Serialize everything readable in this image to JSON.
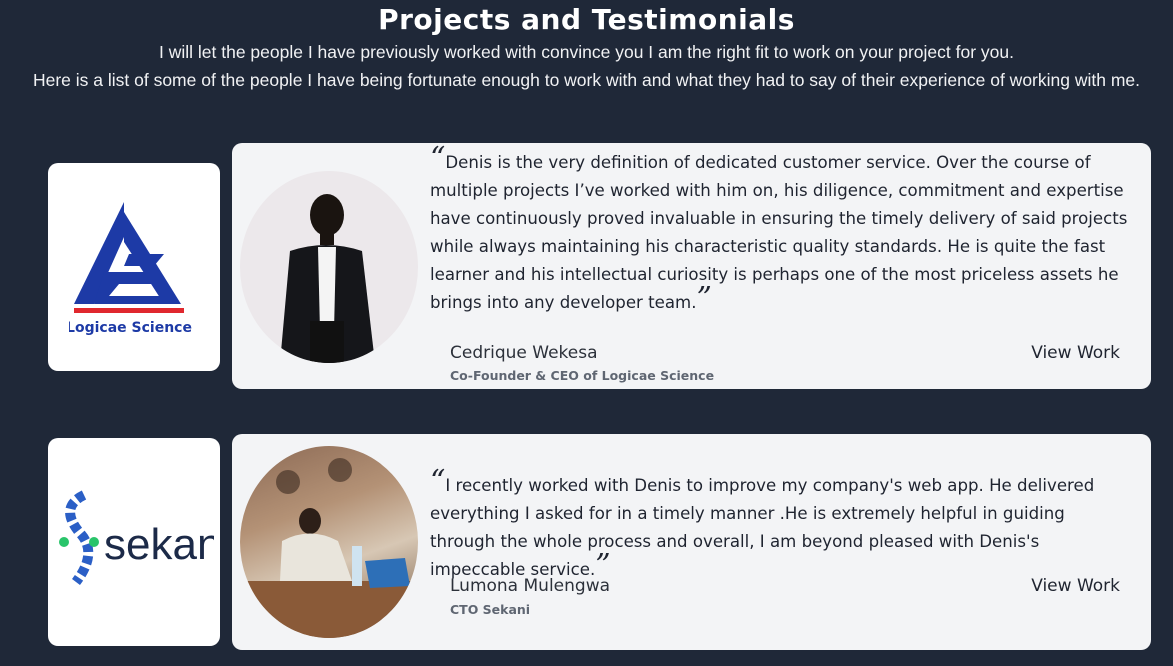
{
  "header": {
    "title": "Projects and Testimonials",
    "intro_line1": "I will let the people I have previously worked with convince you I am the right fit to work on your project for you.",
    "intro_line2": "Here is a list of some of the people I have being fortunate enough to work with and what they had to say of their experience of working with me."
  },
  "testimonials": [
    {
      "company_logo_text": "Logicae Science",
      "quote": "Denis is the very definition of dedicated customer service. Over the course of multiple projects I’ve worked with him on, his diligence, commitment and expertise have continuously proved invaluable in ensuring the timely delivery of said projects while always maintaining his characteristic quality standards. He is quite the fast learner and his intellectual curiosity is perhaps one of the most priceless assets he brings into any developer team.",
      "name": "Cedrique Wekesa",
      "role": "Co-Founder & CEO of Logicae Science",
      "action_label": "View Work"
    },
    {
      "company_logo_text": "sekani",
      "quote": "I recently worked with Denis to improve my company's web app. He delivered everything I asked for in a timely manner .He is extremely helpful in guiding through the whole process and overall, I am beyond pleased with Denis's impeccable service.",
      "name": "Lumona Mulengwa",
      "role": "CTO Sekani",
      "action_label": "View Work"
    }
  ],
  "colors": {
    "page_bg": "#1f2838",
    "card_bg": "#f3f4f6",
    "logicae_blue": "#1d3aa6",
    "logicae_red": "#e0282e",
    "sekani_blue": "#2b5fc6",
    "sekani_green": "#29c46a",
    "sekani_text": "#1c2a48"
  }
}
